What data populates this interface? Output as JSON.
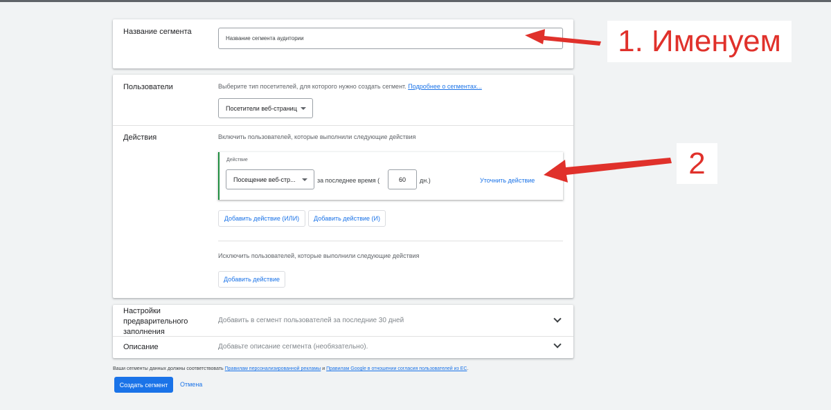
{
  "segment_name": {
    "label": "Название сегмента",
    "placeholder": "Название сегмента аудитории"
  },
  "users": {
    "label": "Пользователи",
    "description": "Выберите тип посетителей, для которого нужно создать сегмент.",
    "learn_more_link": "Подробнее о сегментах...",
    "type_value": "Посетители веб-страниц"
  },
  "actions": {
    "label": "Действия",
    "include_text": "Включить пользователей, которые выполнили следующие действия",
    "action_caption": "Действие",
    "action_value": "Посещение веб-стр...",
    "period_prefix": "за последнее время (",
    "days_value": "60",
    "period_suffix": "дн.)",
    "refine_link": "Уточнить действие",
    "add_or_button": "Добавить действие (ИЛИ)",
    "add_and_button": "Добавить действие (И)",
    "exclude_text": "Исключить пользователей, которые выполнили следующие действия",
    "add_exclude_button": "Добавить действие"
  },
  "prefill": {
    "label": "Настройки предварительного заполнения",
    "value": "Добавить в сегмент пользователей за последние 30 дней"
  },
  "description": {
    "label": "Описание",
    "value": "Добавьте описание сегмента (необязательно)."
  },
  "footer": {
    "policy_prefix": "Ваши сегменты данных должны соответствовать",
    "policy_link_1": "Правилам персонализированной рекламы",
    "policy_and": "и",
    "policy_link_2": "Правилам Google в отношении согласия пользователей из ЕС",
    "create_button": "Создать сегмент",
    "cancel_button": "Отмена"
  },
  "annotations": {
    "callout_1": "1. Именуем",
    "callout_2": "2",
    "arrow_color": "#e0312b"
  },
  "colors": {
    "accent": "#1a73e8",
    "action_border": "#1e8e3e",
    "background": "#f1f3f4"
  }
}
